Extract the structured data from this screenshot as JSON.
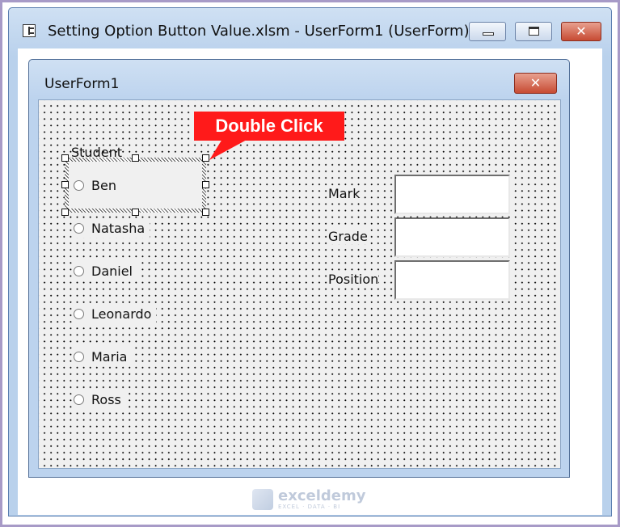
{
  "outer_window": {
    "title": "Setting Option Button Value.xlsm - UserForm1 (UserForm)",
    "close_glyph": "✕"
  },
  "userform": {
    "title": "UserForm1",
    "close_glyph": "✕",
    "frame_label": "Student",
    "options": [
      "Ben",
      "Natasha",
      "Daniel",
      "Leonardo",
      "Maria",
      "Ross"
    ],
    "fields": [
      {
        "label": "Mark",
        "value": ""
      },
      {
        "label": "Grade",
        "value": ""
      },
      {
        "label": "Position",
        "value": ""
      }
    ]
  },
  "annotation": {
    "callout_text": "Double Click",
    "color": "#ff1a1a"
  },
  "watermark": {
    "brand": "exceldemy",
    "tagline": "EXCEL · DATA · BI"
  }
}
